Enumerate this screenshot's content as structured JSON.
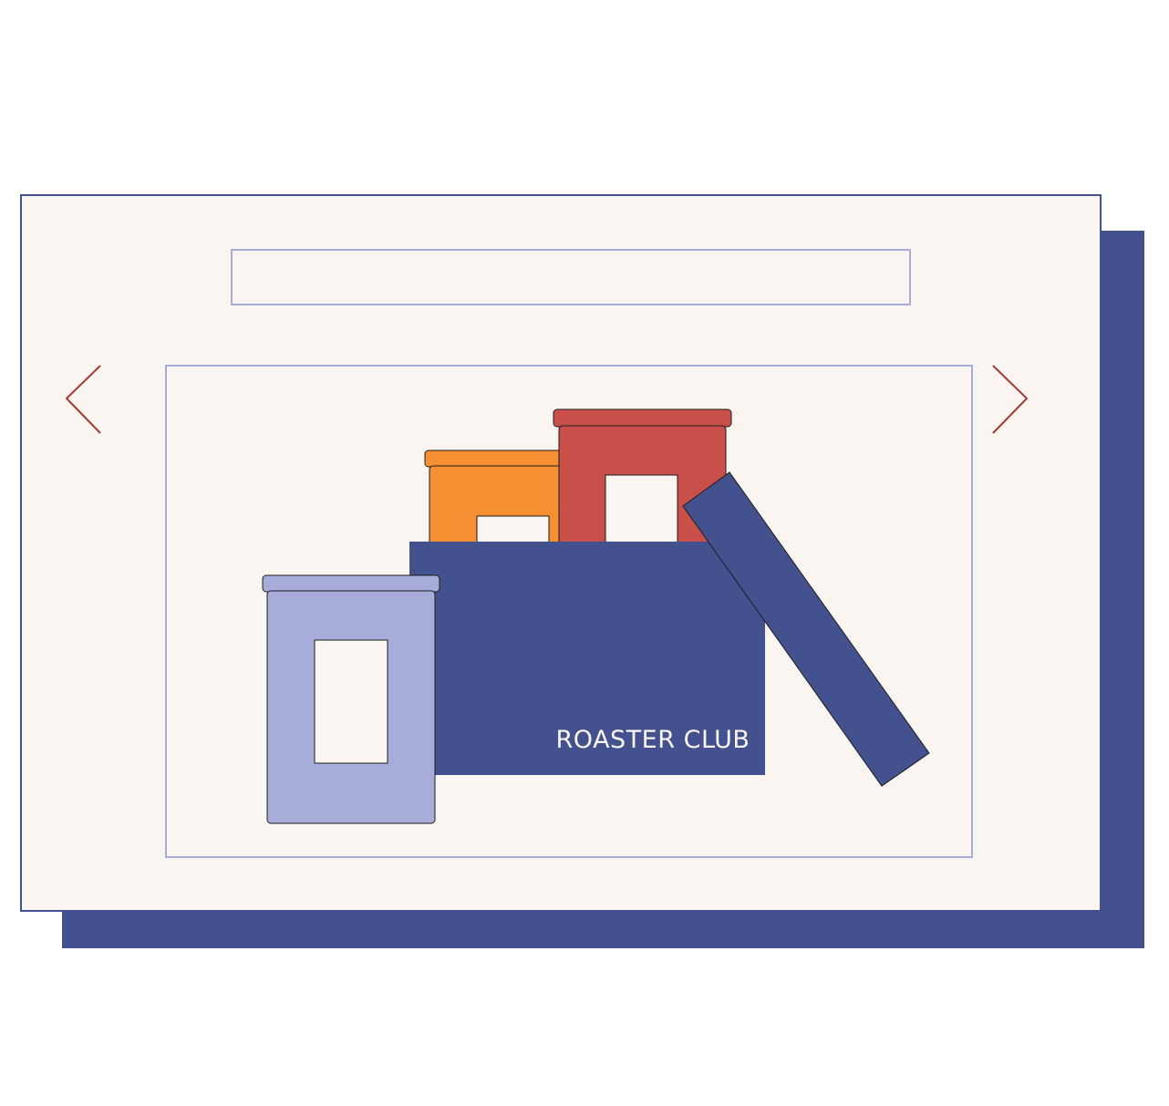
{
  "window": {
    "address_bar_value": ""
  },
  "carousel": {
    "prev_icon": "chevron-left-icon",
    "next_icon": "chevron-right-icon",
    "slide": {
      "brand_text": "ROASTER CLUB",
      "canisters": [
        "blue-canister",
        "orange-canister",
        "red-canister"
      ]
    }
  },
  "colors": {
    "navy": "#43528f",
    "cream": "#faf5f0",
    "lavender": "#a7acd8",
    "orange": "#f69033",
    "red": "#c94f4a",
    "arrow": "#a23b33"
  }
}
